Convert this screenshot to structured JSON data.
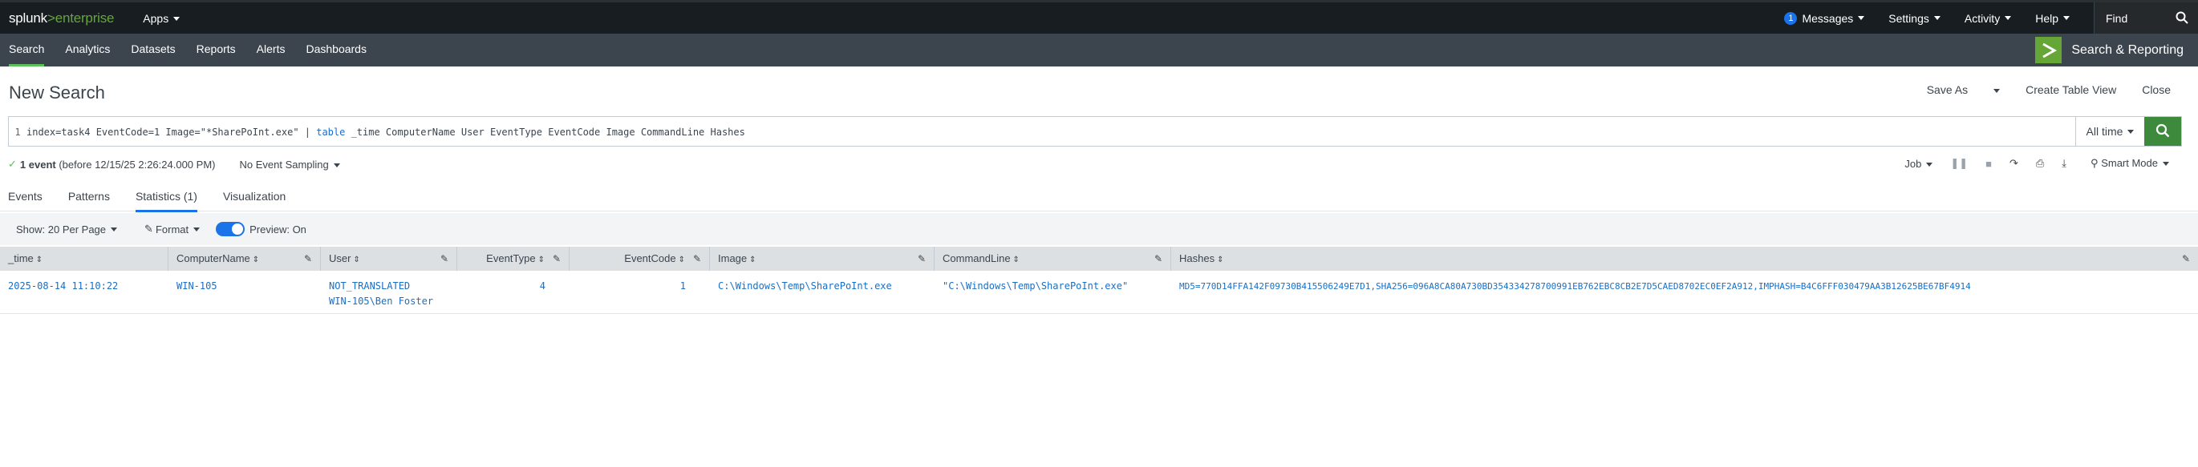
{
  "topbar": {
    "logo_main": "splunk",
    "logo_sep": ">",
    "logo_product": "enterprise",
    "apps_label": "Apps",
    "messages_count": "1",
    "messages_label": "Messages",
    "settings_label": "Settings",
    "activity_label": "Activity",
    "help_label": "Help",
    "find_label": "Find"
  },
  "appbar": {
    "tabs": [
      "Search",
      "Analytics",
      "Datasets",
      "Reports",
      "Alerts",
      "Dashboards"
    ],
    "app_name": "Search & Reporting"
  },
  "page": {
    "title": "New Search",
    "save_as": "Save As",
    "create_table_view": "Create Table View",
    "close": "Close"
  },
  "search": {
    "line_number": "1",
    "query_part1": "index=task4 EventCode=1 Image=\"*SharePoInt.exe\" | ",
    "query_keyword": "table",
    "query_part2": " _time ComputerName User EventType EventCode Image CommandLine Hashes",
    "time_range": "All time"
  },
  "status": {
    "event_count": "1 event",
    "event_suffix": "(before 12/15/25 2:26:24.000 PM)",
    "sampling": "No Event Sampling",
    "job_label": "Job",
    "mode_label": "Smart Mode"
  },
  "result_tabs": [
    "Events",
    "Patterns",
    "Statistics (1)",
    "Visualization"
  ],
  "options": {
    "per_page": "Show: 20 Per Page",
    "format": "Format",
    "preview": "Preview: On"
  },
  "table": {
    "columns": [
      "_time",
      "ComputerName",
      "User",
      "EventType",
      "EventCode",
      "Image",
      "CommandLine",
      "Hashes"
    ],
    "row": {
      "time": "2025-08-14 11:10:22",
      "computer": "WIN-105",
      "user_line1": "NOT_TRANSLATED",
      "user_line2": "WIN-105\\Ben Foster",
      "event_type": "4",
      "event_code": "1",
      "image": "C:\\Windows\\Temp\\SharePoInt.exe",
      "command_line": "\"C:\\Windows\\Temp\\SharePoInt.exe\"",
      "hashes": "MD5=770D14FFA142F09730B415506249E7D1,SHA256=096A8CA80A730BD354334278700991EB762EBC8CB2E7D5CAED8702EC0EF2A912,IMPHASH=B4C6FFF030479AA3B12625BE67BF4914"
    }
  },
  "colors": {
    "topbar_bg": "#171d21",
    "appbar_bg": "#3c444d",
    "accent_green": "#65a637",
    "link_blue": "#1a6fc4"
  }
}
